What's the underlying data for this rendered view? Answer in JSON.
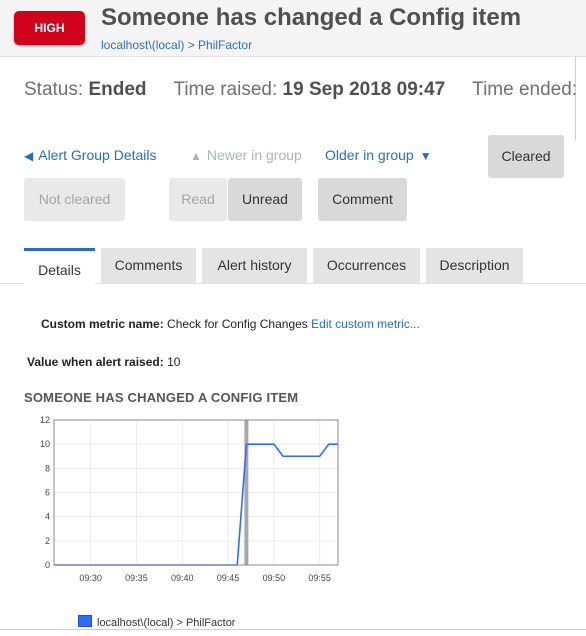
{
  "header": {
    "severity": "HIGH",
    "title": "Someone has changed a Config item",
    "breadcrumb": "localhost\\(local) > PhilFactor"
  },
  "status": {
    "status_label": "Status:",
    "status_value": "Ended",
    "raised_label": "Time raised:",
    "raised_value": "19 Sep 2018 09:47",
    "ended_label": "Time ended:"
  },
  "nav": {
    "group_details": "Alert Group Details",
    "newer": "Newer in group",
    "older": "Older in group"
  },
  "buttons": {
    "cleared": "Cleared",
    "not_cleared": "Not cleared",
    "read": "Read",
    "unread": "Unread",
    "comment": "Comment"
  },
  "tabs": [
    "Details",
    "Comments",
    "Alert history",
    "Occurrences",
    "Description"
  ],
  "details": {
    "metric_label": "Custom metric name:",
    "metric_value": "Check for Config Changes",
    "metric_link": "Edit custom metric...",
    "value_label": "Value when alert raised:",
    "value_value": "10"
  },
  "chart_data": {
    "type": "line",
    "title": "SOMEONE HAS CHANGED A CONFIG ITEM",
    "x_ticks": [
      "09:30",
      "09:35",
      "09:40",
      "09:45",
      "09:50",
      "09:55"
    ],
    "y_ticks": [
      0,
      2,
      4,
      6,
      8,
      10,
      12
    ],
    "ylim": [
      0,
      12
    ],
    "xlim_minutes": [
      "09:26",
      "09:57"
    ],
    "marker_time": "09:47",
    "series": [
      {
        "name": "localhost\\(local) > PhilFactor",
        "color": "#2f6bff",
        "points": [
          {
            "t": "09:26",
            "v": 0
          },
          {
            "t": "09:46",
            "v": 0
          },
          {
            "t": "09:47",
            "v": 10
          },
          {
            "t": "09:50",
            "v": 10
          },
          {
            "t": "09:51",
            "v": 9
          },
          {
            "t": "09:55",
            "v": 9
          },
          {
            "t": "09:56",
            "v": 10
          },
          {
            "t": "09:57",
            "v": 10
          }
        ]
      }
    ],
    "grid": true
  }
}
